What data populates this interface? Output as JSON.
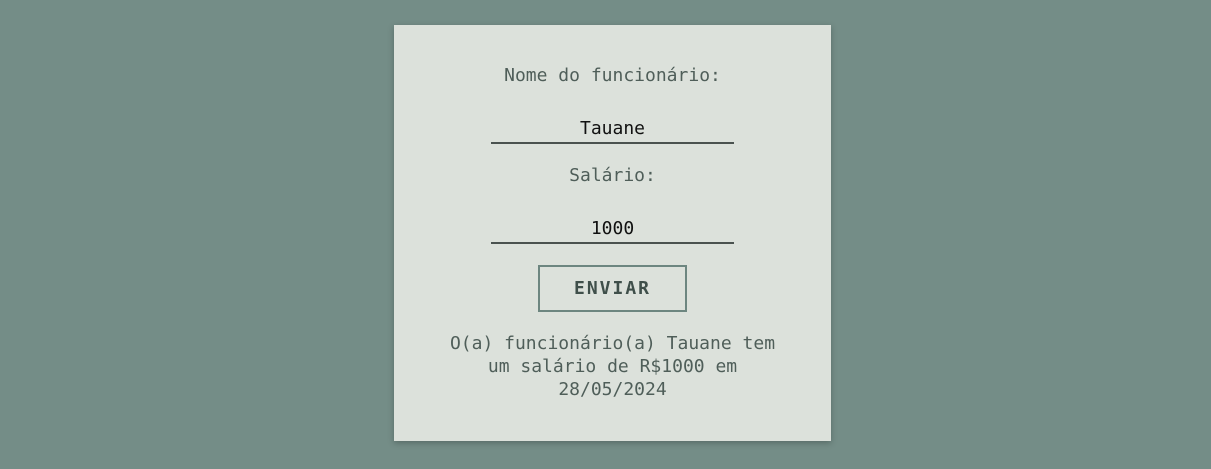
{
  "form": {
    "name_label": "Nome do funcionário:",
    "name_value": "Tauane",
    "salary_label": "Salário:",
    "salary_value": "1000",
    "submit_label": "ENVIAR",
    "result_text": "O(a) funcionário(a) Tauane tem\num salário de R$1000 em\n28/05/2024"
  },
  "colors": {
    "background": "#748d87",
    "card": "#dce1db",
    "text": "#4f5e59",
    "button_border": "#6d8680"
  }
}
